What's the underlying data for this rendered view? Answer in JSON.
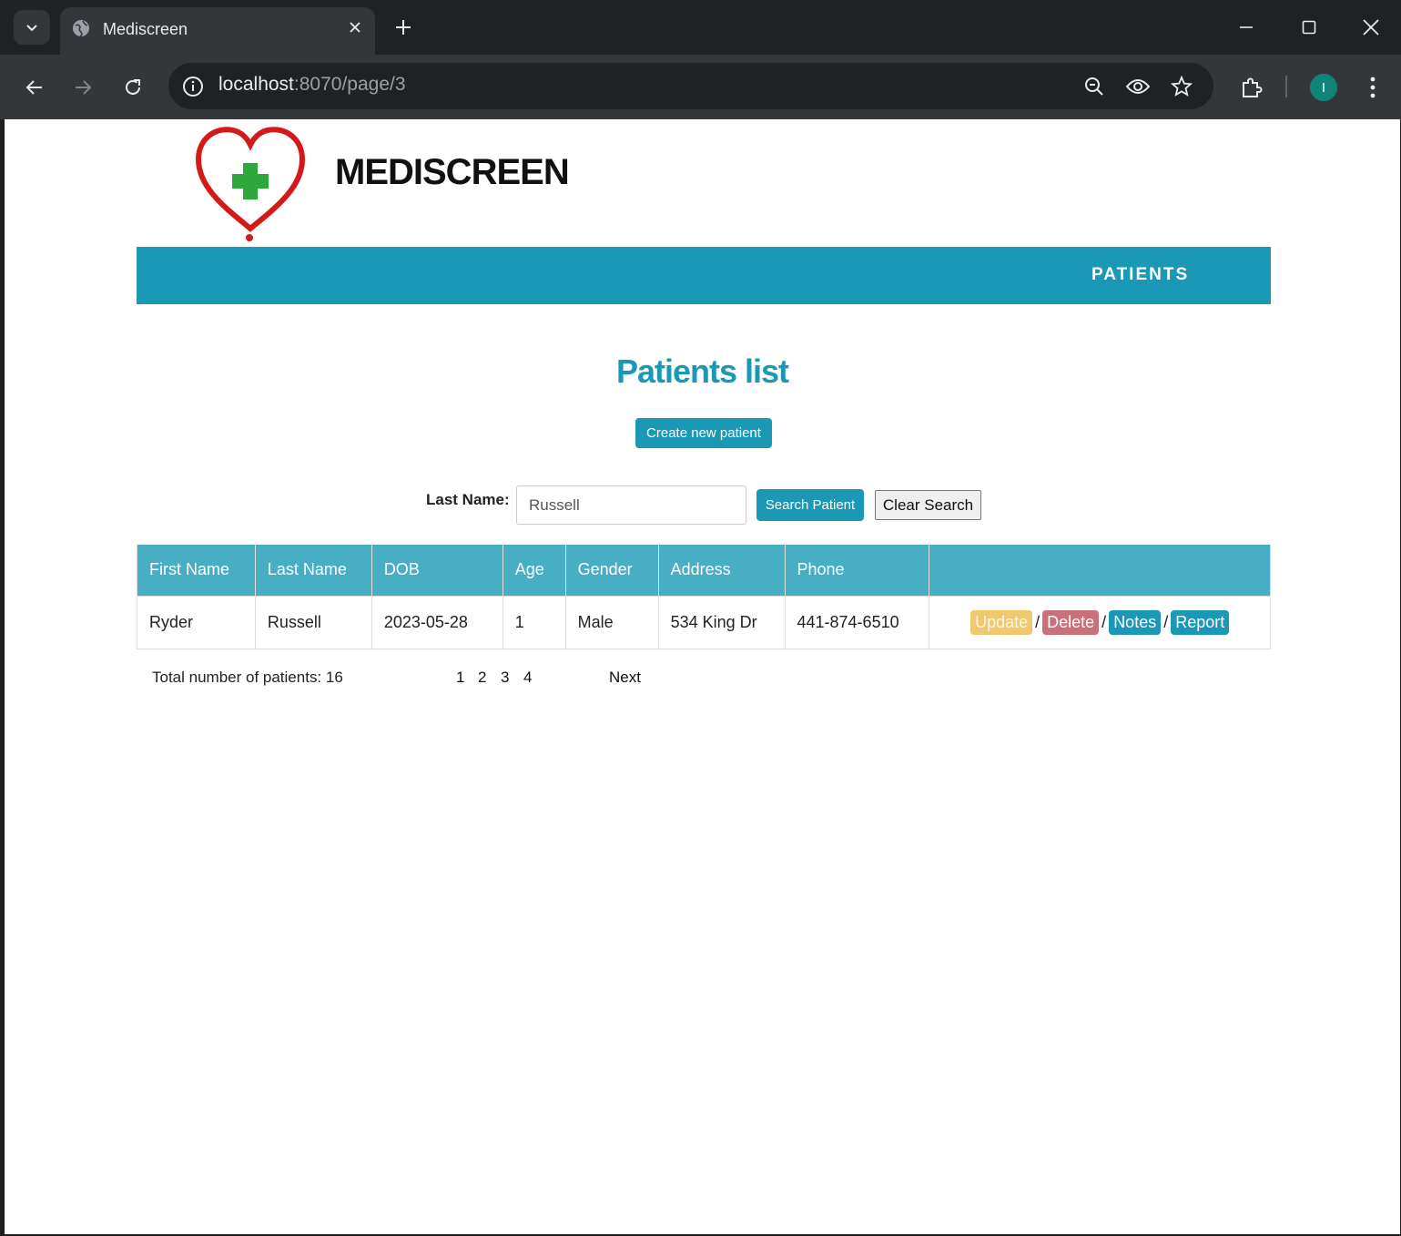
{
  "browser": {
    "tab_title": "Mediscreen",
    "url_host": "localhost",
    "url_path": ":8070/page/3",
    "avatar_letter": "I"
  },
  "header": {
    "brand": "MEDISCREEN",
    "nav": {
      "patients": "PATIENTS"
    }
  },
  "main": {
    "title": "Patients list",
    "create_button": "Create new patient",
    "search": {
      "label": "Last Name:",
      "value": "Russell",
      "search_button": "Search Patient",
      "clear_button": "Clear Search"
    },
    "table": {
      "headers": [
        "First Name",
        "Last Name",
        "DOB",
        "Age",
        "Gender",
        "Address",
        "Phone",
        ""
      ],
      "rows": [
        {
          "first_name": "Ryder",
          "last_name": "Russell",
          "dob": "2023-05-28",
          "age": "1",
          "gender": "Male",
          "address": "534 King Dr",
          "phone": "441-874-6510",
          "actions": {
            "update": "Update",
            "delete": "Delete",
            "notes": "Notes",
            "report": "Report",
            "separator": "/"
          }
        }
      ]
    },
    "pagination": {
      "total": "Total number of patients: 16",
      "pages": [
        "1",
        "2",
        "3",
        "4"
      ],
      "next": "Next"
    }
  },
  "colors": {
    "accent": "#1a98b5",
    "table_header": "#48aec4",
    "update": "#f0c870",
    "delete": "#c9707a"
  }
}
